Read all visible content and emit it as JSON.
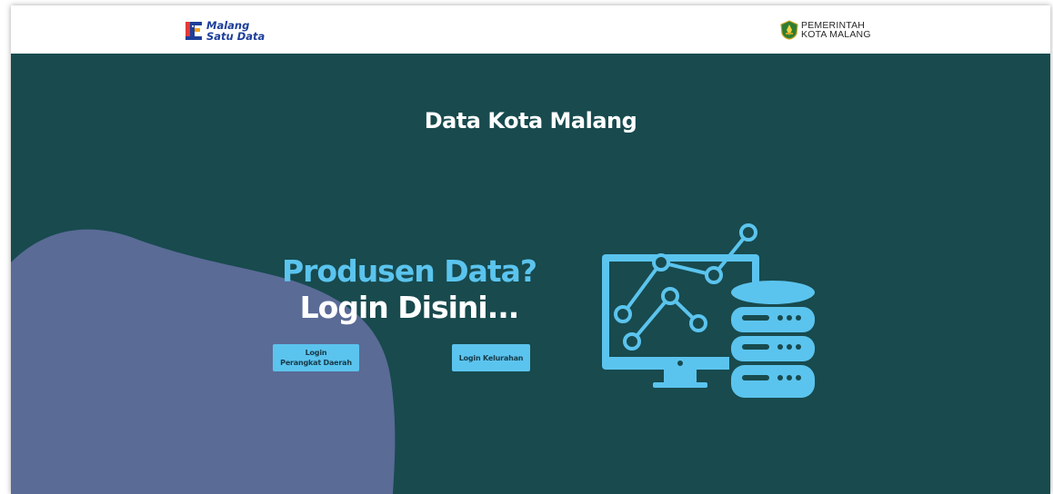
{
  "header": {
    "brand_line1": "Malang",
    "brand_line2": "Satu Data",
    "gov_line1": "PEMERINTAH",
    "gov_line2": "KOTA MALANG"
  },
  "hero": {
    "title": "Data Kota Malang",
    "question": "Produsen Data?",
    "cta": "Login Disini...",
    "buttons": {
      "perangkat_line1": "Login",
      "perangkat_line2": "Perangkat Daerah",
      "kelurahan": "Login Kelurahan"
    }
  },
  "colors": {
    "hero_bg": "#184a4e",
    "accent": "#5bc4ee",
    "blob": "#5a6b96",
    "brand_blue": "#1d3f9a"
  },
  "icons": [
    "malang-satu-data-logo-icon",
    "pemerintah-kota-malang-emblem-icon",
    "data-analytics-monitor-icon",
    "database-server-icon"
  ]
}
